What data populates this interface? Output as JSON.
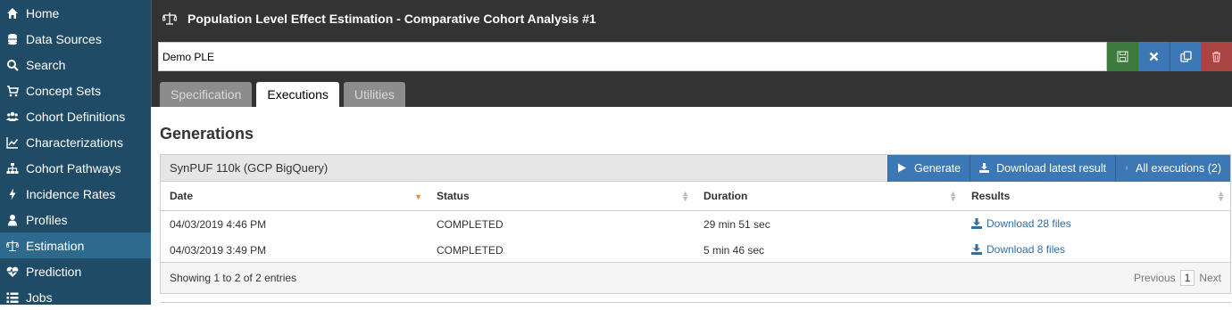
{
  "sidebar": {
    "items": [
      {
        "label": "Home",
        "icon": "home-icon"
      },
      {
        "label": "Data Sources",
        "icon": "database-icon"
      },
      {
        "label": "Search",
        "icon": "search-icon"
      },
      {
        "label": "Concept Sets",
        "icon": "cart-icon"
      },
      {
        "label": "Cohort Definitions",
        "icon": "users-icon"
      },
      {
        "label": "Characterizations",
        "icon": "line-chart-icon"
      },
      {
        "label": "Cohort Pathways",
        "icon": "sitemap-icon"
      },
      {
        "label": "Incidence Rates",
        "icon": "bolt-icon"
      },
      {
        "label": "Profiles",
        "icon": "user-icon"
      },
      {
        "label": "Estimation",
        "icon": "balance-scale-icon",
        "active": true
      },
      {
        "label": "Prediction",
        "icon": "heartbeat-icon"
      },
      {
        "label": "Jobs",
        "icon": "list-icon"
      }
    ]
  },
  "header": {
    "title": "Population Level Effect Estimation - Comparative Cohort Analysis #1",
    "name_value": "Demo PLE",
    "colors": {
      "save": "#3d7a3d",
      "close": "#3c78b5",
      "copy": "#3c78b5",
      "delete": "#a94442"
    }
  },
  "tabs": [
    {
      "label": "Specification",
      "active": false
    },
    {
      "label": "Executions",
      "active": true
    },
    {
      "label": "Utilities",
      "active": false
    }
  ],
  "generations": {
    "title": "Generations",
    "source_name": "SynPUF 110k (GCP BigQuery)",
    "buttons": {
      "generate": "Generate",
      "download_latest": "Download latest result",
      "all_executions": "All executions (2)"
    },
    "columns": [
      "Date",
      "Status",
      "Duration",
      "Results"
    ],
    "rows": [
      {
        "date": "04/03/2019 4:46 PM",
        "status": "COMPLETED",
        "duration": "29 min 51 sec",
        "results": "Download 28 files"
      },
      {
        "date": "04/03/2019 3:49 PM",
        "status": "COMPLETED",
        "duration": "5 min 46 sec",
        "results": "Download 8 files"
      }
    ],
    "footer": {
      "info": "Showing 1 to 2 of 2 entries",
      "previous": "Previous",
      "page": "1",
      "next": "Next"
    }
  }
}
